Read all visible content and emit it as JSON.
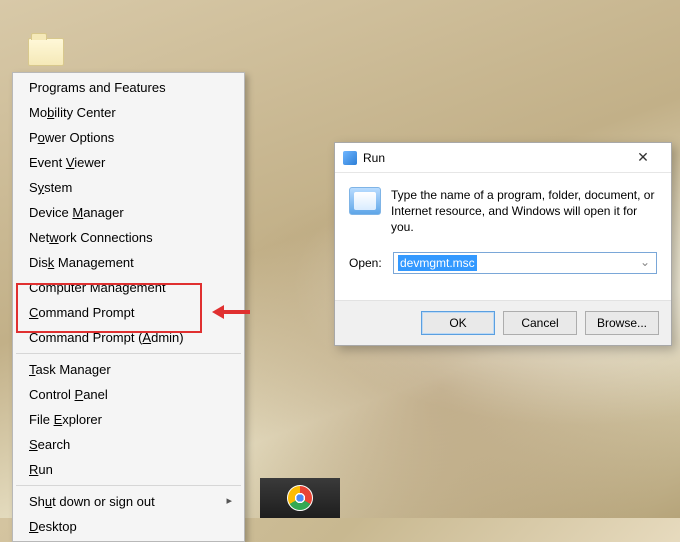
{
  "context_menu": {
    "groups": [
      [
        {
          "label": "Programs and Features",
          "accel": ""
        },
        {
          "label": "Mobility Center",
          "accel": "b",
          "render": "Mo<u>b</u>ility Center"
        },
        {
          "label": "Power Options",
          "accel": "O",
          "render": "P<u>o</u>wer Options"
        },
        {
          "label": "Event Viewer",
          "accel": "V",
          "render": "Event <u>V</u>iewer"
        },
        {
          "label": "System",
          "accel": "y",
          "render": "S<u>y</u>stem"
        },
        {
          "label": "Device Manager",
          "accel": "M",
          "render": "Device <u>M</u>anager"
        },
        {
          "label": "Network Connections",
          "accel": "W",
          "render": "Net<u>w</u>ork Connections"
        },
        {
          "label": "Disk Management",
          "accel": "k",
          "render": "Dis<u>k</u> Management"
        },
        {
          "label": "Computer Management",
          "accel": "G",
          "render": "Computer Mana<u>g</u>ement"
        },
        {
          "label": "Command Prompt",
          "accel": "C",
          "render": "<u>C</u>ommand Prompt"
        },
        {
          "label": "Command Prompt (Admin)",
          "accel": "A",
          "render": "Command Prompt (<u>A</u>dmin)"
        }
      ],
      [
        {
          "label": "Task Manager",
          "accel": "T",
          "render": "<u>T</u>ask Manager"
        },
        {
          "label": "Control Panel",
          "accel": "P",
          "render": "Control <u>P</u>anel"
        },
        {
          "label": "File Explorer",
          "accel": "E",
          "render": "File <u>E</u>xplorer"
        },
        {
          "label": "Search",
          "accel": "S",
          "render": "<u>S</u>earch"
        },
        {
          "label": "Run",
          "accel": "R",
          "render": "<u>R</u>un"
        }
      ],
      [
        {
          "label": "Shut down or sign out",
          "accel": "U",
          "render": "Sh<u>u</u>t down or sign out",
          "submenu": true
        },
        {
          "label": "Desktop",
          "accel": "D",
          "render": "<u>D</u>esktop"
        }
      ]
    ]
  },
  "highlight": {
    "items": [
      "Command Prompt",
      "Command Prompt (Admin)"
    ]
  },
  "run_dialog": {
    "title": "Run",
    "description": "Type the name of a program, folder, document, or Internet resource, and Windows will open it for you.",
    "open_label": "Open:",
    "input_value": "devmgmt.msc",
    "buttons": {
      "ok": "OK",
      "cancel": "Cancel",
      "browse": "Browse..."
    }
  },
  "taskbar": {
    "items": [
      "chrome"
    ]
  }
}
